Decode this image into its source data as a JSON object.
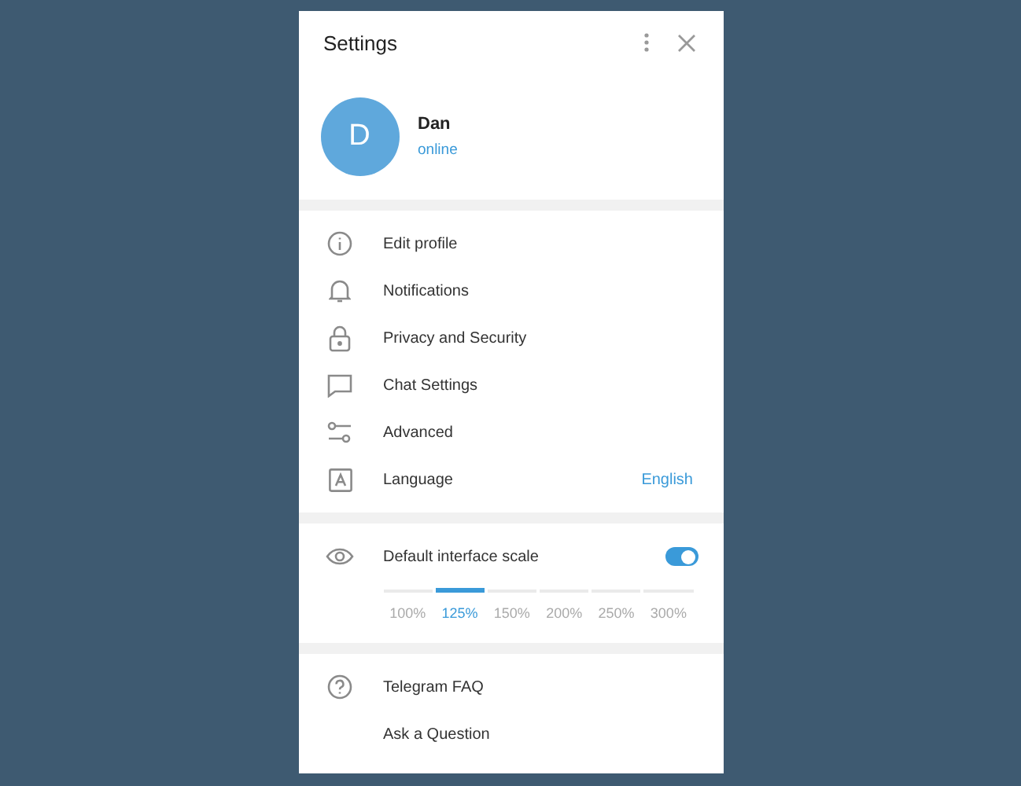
{
  "window": {
    "title": "Settings"
  },
  "profile": {
    "initial": "D",
    "name": "Dan",
    "status": "online"
  },
  "menu": [
    {
      "label": "Edit profile"
    },
    {
      "label": "Notifications"
    },
    {
      "label": "Privacy and Security"
    },
    {
      "label": "Chat Settings"
    },
    {
      "label": "Advanced"
    },
    {
      "label": "Language",
      "value": "English"
    }
  ],
  "scale": {
    "label": "Default interface scale",
    "on": true,
    "options": [
      {
        "label": "100%",
        "selected": false
      },
      {
        "label": "125%",
        "selected": true
      },
      {
        "label": "150%",
        "selected": false
      },
      {
        "label": "200%",
        "selected": false
      },
      {
        "label": "250%",
        "selected": false
      },
      {
        "label": "300%",
        "selected": false
      }
    ]
  },
  "help": [
    {
      "label": "Telegram FAQ"
    },
    {
      "label": "Ask a Question"
    }
  ]
}
